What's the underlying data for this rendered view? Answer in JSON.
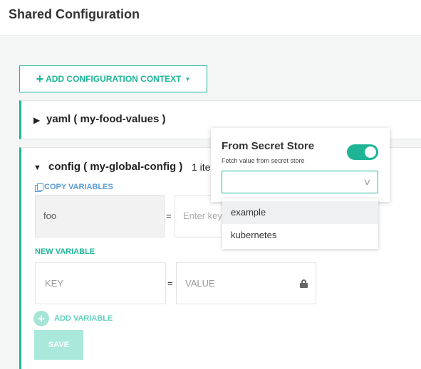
{
  "header": {
    "title": "Shared Configuration"
  },
  "toolbar": {
    "add_context_label": "ADD CONFIGURATION CONTEXT"
  },
  "contexts": [
    {
      "name": "yaml ( my-food-values )",
      "expanded": false
    },
    {
      "name": "config ( my-global-config )",
      "expanded": true,
      "count_label": "1 ite"
    }
  ],
  "config_panel": {
    "copy_variables_label": "COPY VARIABLES",
    "variables": [
      {
        "key": "foo",
        "value_placeholder": "Enter key"
      }
    ],
    "new_variable_label": "NEW VARIABLE",
    "key_placeholder": "KEY",
    "value_placeholder": "VALUE",
    "add_variable_label": "ADD VARIABLE",
    "save_label": "SAVE"
  },
  "secret_popup": {
    "heading": "From Secret Store",
    "subtext": "Fetch value from secret store",
    "toggle_on": true,
    "selected_value": "",
    "options": [
      "example",
      "kubernetes"
    ],
    "highlighted_option": "example"
  },
  "colors": {
    "accent": "#1eb597",
    "link": "#5b9bd5",
    "disabled_button": "#a9e8db"
  },
  "icons": [
    "plus-icon",
    "caret-down-icon",
    "triangle-right-icon",
    "triangle-down-icon",
    "copy-icon",
    "lock-icon",
    "plus-circle-icon",
    "chevron-down-icon"
  ]
}
